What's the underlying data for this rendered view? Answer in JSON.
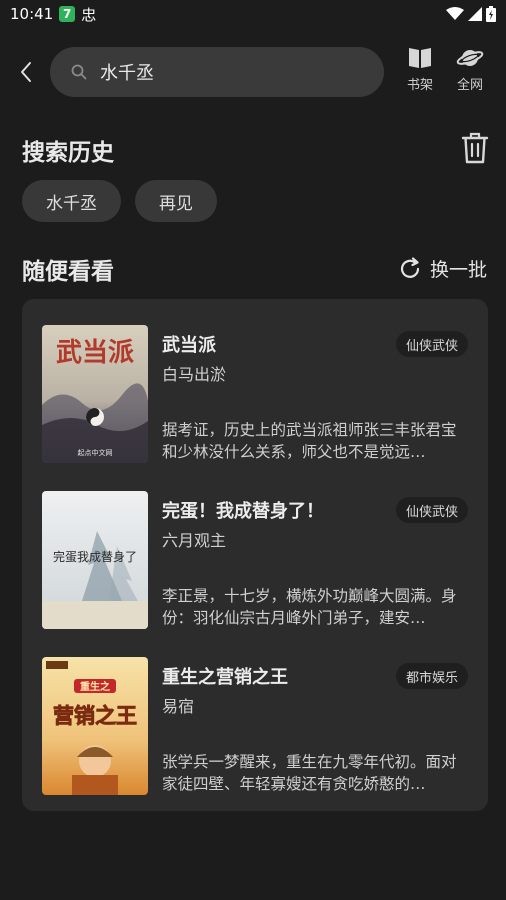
{
  "status_bar": {
    "time": "10:41",
    "app_badge": "7",
    "bug_glyph": "忠"
  },
  "header": {
    "search_value": "水千丞",
    "shelf_label": "书架",
    "web_label": "全网"
  },
  "history": {
    "title": "搜索历史",
    "chips": [
      "水千丞",
      "再见"
    ]
  },
  "random": {
    "title": "随便看看",
    "refresh_label": "换一批"
  },
  "books": [
    {
      "title": "武当派",
      "author": "白马出淤",
      "tag": "仙侠武侠",
      "desc": "据考证，历史上的武当派祖师张三丰张君宝和少林没什么关系，师父也不是觉远…",
      "cover_text": "武当派",
      "cover_footer": "起点中文网"
    },
    {
      "title": "完蛋！我成替身了！",
      "author": "六月观主",
      "tag": "仙侠武侠",
      "desc": "李正景，十七岁，横炼外功巅峰大圆满。身份：羽化仙宗古月峰外门弟子，建安…",
      "cover_text": "完蛋我成替身了"
    },
    {
      "title": "重生之营销之王",
      "author": "易宿",
      "tag": "都市娱乐",
      "desc": "张学兵一梦醒来，重生在九零年代初。面对家徒四壁、年轻寡嫂还有贪吃娇憨的…",
      "cover_top": "重生之",
      "cover_main": "营销之王"
    }
  ]
}
